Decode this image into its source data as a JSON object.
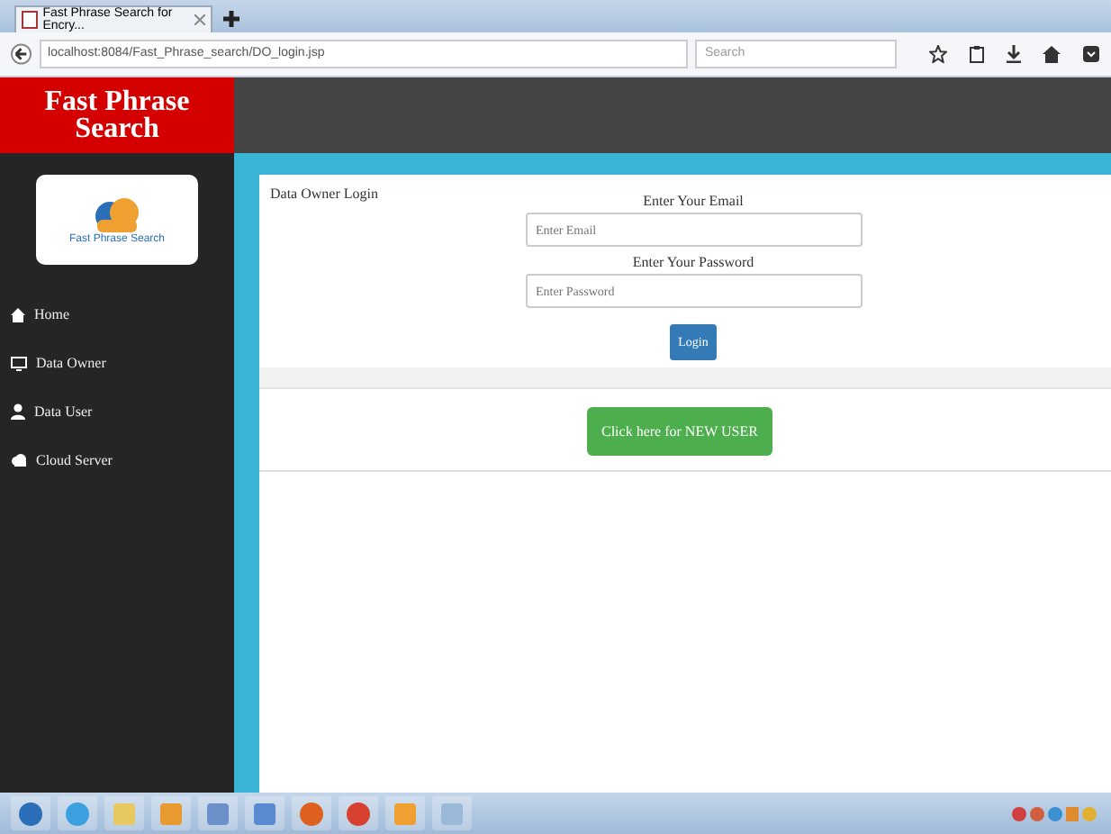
{
  "browser": {
    "tab_title": "Fast Phrase Search for Encry...",
    "address": "localhost:8084/Fast_Phrase_search/DO_login.jsp",
    "search": {
      "placeholder": "Search"
    }
  },
  "header": {
    "brand": "Fast Phrase Search"
  },
  "sidebar": {
    "logo_text": "Fast Phrase Search",
    "items": [
      {
        "label": "Home",
        "kind": "home"
      },
      {
        "label": "Data Owner",
        "kind": "monitor"
      },
      {
        "label": "Data User",
        "kind": "user"
      },
      {
        "label": "Cloud Server",
        "kind": "cloud"
      }
    ]
  },
  "login": {
    "title": "Data Owner Login",
    "email_label": "Enter Your Email",
    "email": {
      "placeholder": "Enter Email"
    },
    "password_label": "Enter Your Password",
    "password": {
      "placeholder": "Enter Password"
    },
    "submit": "Login",
    "new_user": "Click here for NEW USER"
  },
  "taskbar": {
    "apps": [
      {
        "kind": "start"
      },
      {
        "kind": "ie"
      },
      {
        "kind": "folder"
      },
      {
        "kind": "media"
      },
      {
        "kind": "doc"
      },
      {
        "kind": "tool"
      },
      {
        "kind": "firefox"
      },
      {
        "kind": "chrome"
      },
      {
        "kind": "app"
      },
      {
        "kind": "box"
      }
    ]
  }
}
